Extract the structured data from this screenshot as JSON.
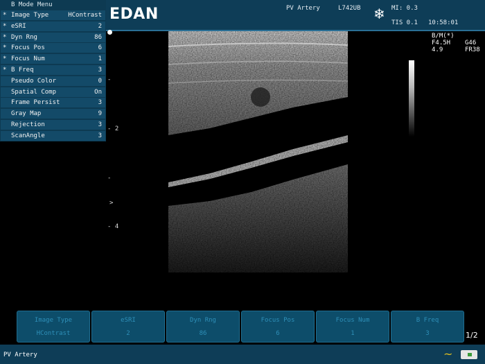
{
  "menu": {
    "title": "B Mode Menu",
    "items": [
      {
        "star": "*",
        "label": "Image Type",
        "value": "HContrast"
      },
      {
        "star": "*",
        "label": "eSRI",
        "value": "2"
      },
      {
        "star": "*",
        "label": "Dyn Rng",
        "value": "86"
      },
      {
        "star": "*",
        "label": "Focus Pos",
        "value": "6"
      },
      {
        "star": "*",
        "label": "Focus Num",
        "value": "1"
      },
      {
        "star": "*",
        "label": "B Freq",
        "value": "3"
      },
      {
        "star": "",
        "label": "Pseudo Color",
        "value": "0"
      },
      {
        "star": "",
        "label": "Spatial Comp",
        "value": "On"
      },
      {
        "star": "",
        "label": "Frame Persist",
        "value": "3"
      },
      {
        "star": "",
        "label": "Gray Map",
        "value": "9"
      },
      {
        "star": "",
        "label": "Rejection",
        "value": "3"
      },
      {
        "star": "",
        "label": "ScanAngle",
        "value": "3"
      }
    ]
  },
  "header": {
    "logo": "EDAN",
    "exam": "PV Artery",
    "probe": "L742UB",
    "mi": "MI: 0.3",
    "tis": "TIS 0.1",
    "time": "10:58:01",
    "freeze_icon": "snowflake-icon"
  },
  "params": {
    "mode": "B/M(*)",
    "freq": "F4.5H",
    "gain": "G46",
    "depth": "4.9",
    "frame_rate": "FR38"
  },
  "depth_scale": {
    "mark_2": "2",
    "mark_4": "4",
    "focus_marker": ">"
  },
  "softkeys": [
    {
      "label": "Image Type",
      "value": "HContrast"
    },
    {
      "label": "eSRI",
      "value": "2"
    },
    {
      "label": "Dyn Rng",
      "value": "86"
    },
    {
      "label": "Focus Pos",
      "value": "6"
    },
    {
      "label": "Focus Num",
      "value": "1"
    },
    {
      "label": "B Freq",
      "value": "3"
    }
  ],
  "page_indicator": "1/2",
  "status": {
    "text": "PV Artery",
    "wave_icon": "wave-icon",
    "usb_icon": "usb-storage-icon"
  }
}
